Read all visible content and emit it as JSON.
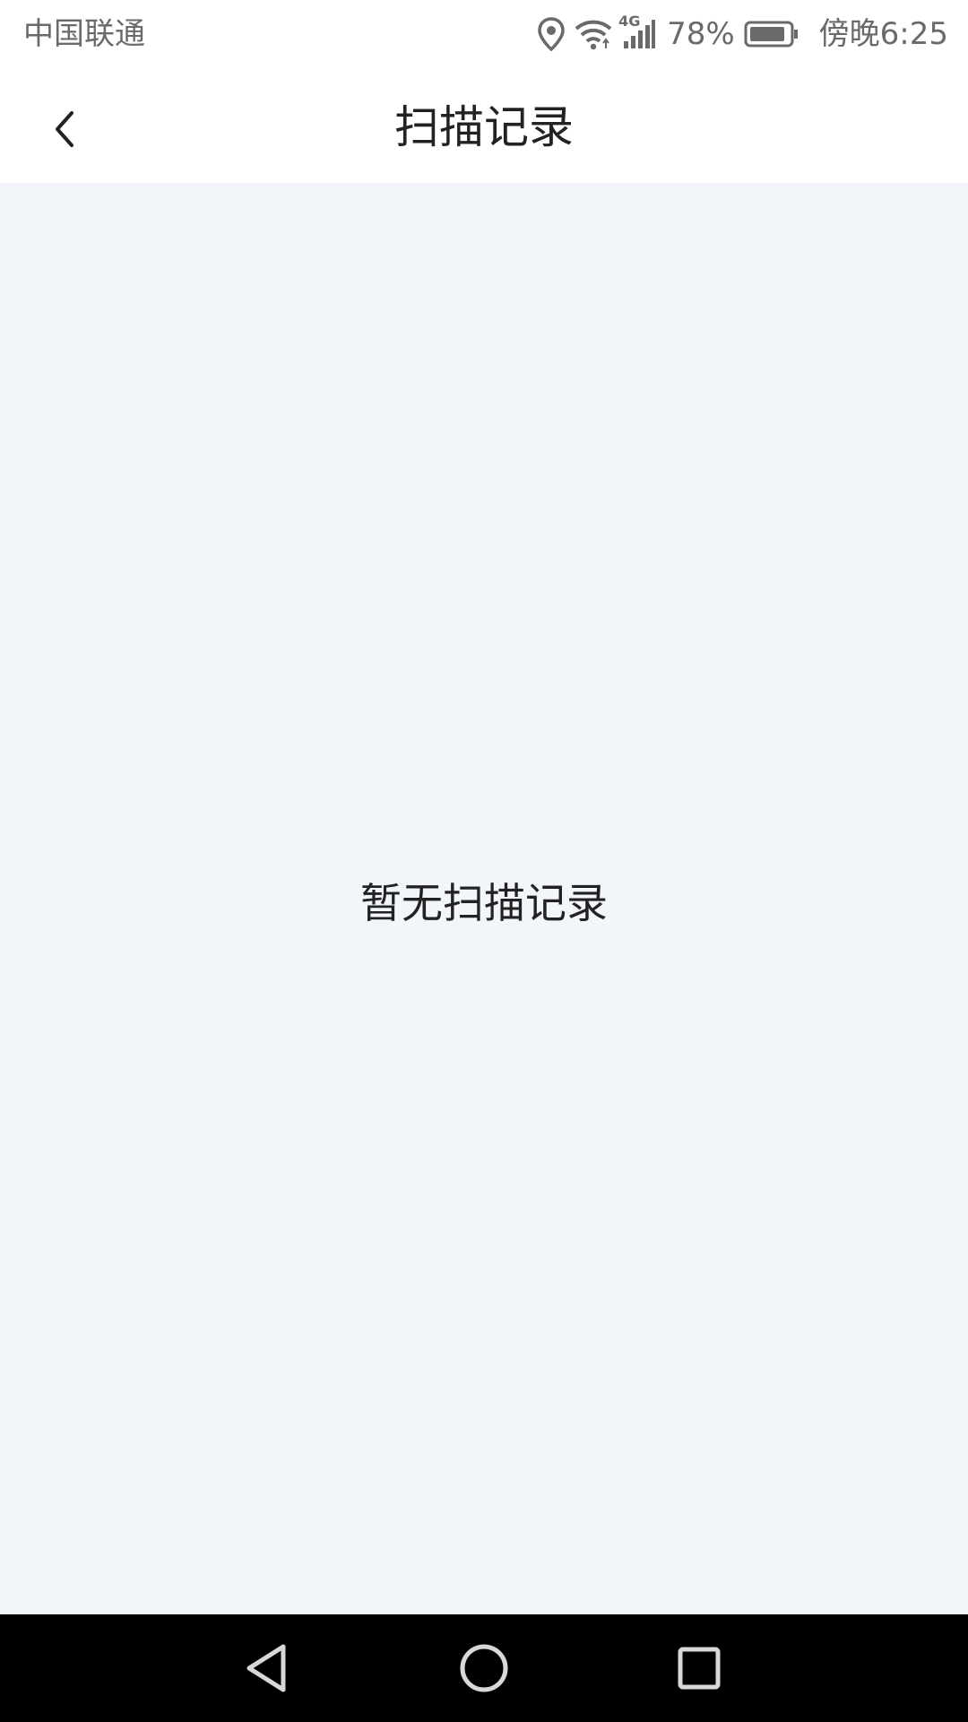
{
  "status_bar": {
    "carrier": "中国联通",
    "network_label": "4G",
    "battery_percent": "78%",
    "time": "傍晚6:25",
    "icons": [
      "location-icon",
      "wifi-icon",
      "signal-icon",
      "battery-icon"
    ]
  },
  "header": {
    "title": "扫描记录",
    "back_icon": "chevron-left-icon"
  },
  "content": {
    "empty_message": "暂无扫描记录",
    "background_color": "#f2f5f9"
  },
  "nav_bar": {
    "buttons": [
      "back-triangle-icon",
      "home-circle-icon",
      "recents-square-icon"
    ]
  }
}
